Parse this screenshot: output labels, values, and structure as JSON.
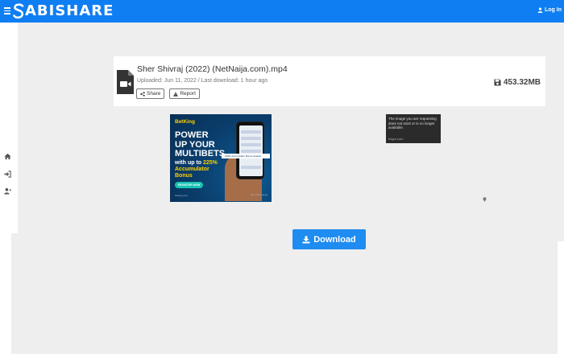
{
  "header": {
    "logo_text": "ABISHARE",
    "logo_full": "SABISHARE",
    "login_label": "Log In"
  },
  "sidebar": {
    "items": [
      {
        "icon": "home-icon"
      },
      {
        "icon": "sign-in-icon"
      },
      {
        "icon": "user-plus-icon"
      }
    ]
  },
  "file": {
    "name": "Sher Shivraj (2022) (NetNaija.com).mp4",
    "meta": "Uploaded: Jun 11, 2022 / Last download: 1 hour ago",
    "share_label": "Share",
    "report_label": "Report",
    "size": "453.32MB",
    "type_icon": "video-file-icon"
  },
  "ad": {
    "brand": "BetKing",
    "headline_1": "POWER",
    "headline_2": "UP YOUR",
    "headline_3": "MULTIBETS",
    "sub_1": "with up to ",
    "sub_pct": "225%",
    "sub_2": "Accumulator",
    "sub_3": "Bonus",
    "cta": "REGISTER NOW",
    "strip": "225% Accumulator Bonus Applied",
    "legal": "betking.com",
    "badge": "18+ T&Cs apply",
    "colors": {
      "bg": "#0a3d6b",
      "accent": "#ffd200",
      "cta": "#17c3b2"
    }
  },
  "image_removed": {
    "message": "The image you are requesting does not exist or is no longer available.",
    "brand": "imgur.com"
  },
  "download": {
    "label": "Download"
  },
  "colors": {
    "brand_blue": "#0f7ef2",
    "download_blue": "#1e8cf1",
    "page_bg": "#eeeeee"
  }
}
